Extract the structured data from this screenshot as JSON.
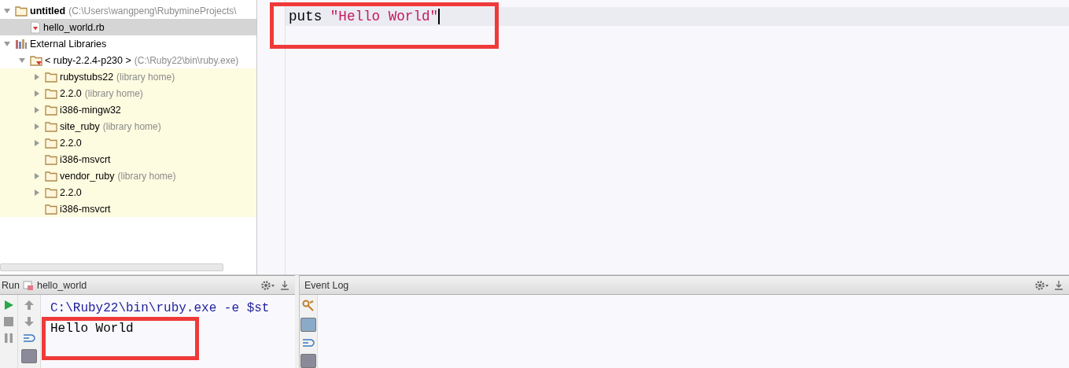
{
  "project_tree": {
    "items": [
      {
        "kind": "folder",
        "label": "untitled",
        "detail": "(C:\\Users\\wangpeng\\RubymineProjects\\",
        "bold": true,
        "expanded": true,
        "selected": false,
        "children": [
          {
            "kind": "ruby-file",
            "label": "hello_world.rb",
            "selected": true
          }
        ]
      },
      {
        "kind": "libraries",
        "label": "External Libraries",
        "expanded": true,
        "selected": false,
        "children": [
          {
            "kind": "sdk",
            "label": "< ruby-2.2.4-p230 >",
            "detail": "(C:\\Ruby22\\bin\\ruby.exe)",
            "expanded": true,
            "selected": false,
            "children": [
              {
                "kind": "folder",
                "label": "rubystubs22",
                "detail": "(library home)",
                "expanded": false,
                "selected": false
              },
              {
                "kind": "folder",
                "label": "2.2.0",
                "detail": "(library home)",
                "expanded": false,
                "selected": false
              },
              {
                "kind": "folder",
                "label": "i386-mingw32",
                "expanded": false,
                "selected": false
              },
              {
                "kind": "folder",
                "label": "site_ruby",
                "detail": "(library home)",
                "expanded": false,
                "selected": false
              },
              {
                "kind": "folder",
                "label": "2.2.0",
                "expanded": false,
                "selected": false
              },
              {
                "kind": "folder",
                "label": "i386-msvcrt",
                "selected": false
              },
              {
                "kind": "folder",
                "label": "vendor_ruby",
                "detail": "(library home)",
                "expanded": false,
                "selected": false
              },
              {
                "kind": "folder",
                "label": "2.2.0",
                "expanded": false,
                "selected": false
              },
              {
                "kind": "folder",
                "label": "i386-msvcrt",
                "selected": false
              }
            ]
          }
        ]
      }
    ]
  },
  "editor": {
    "lines": [
      [
        {
          "kind": "identifier",
          "text": "puts "
        },
        {
          "kind": "string",
          "text": "\"Hello World\""
        }
      ]
    ]
  },
  "run_panel": {
    "title": "Run",
    "tab": "hello_world",
    "console": [
      {
        "kind": "command",
        "text": "C:\\Ruby22\\bin\\ruby.exe -e $st"
      },
      {
        "kind": "output",
        "text": "Hello World"
      }
    ]
  },
  "event_log": {
    "title": "Event Log"
  }
}
